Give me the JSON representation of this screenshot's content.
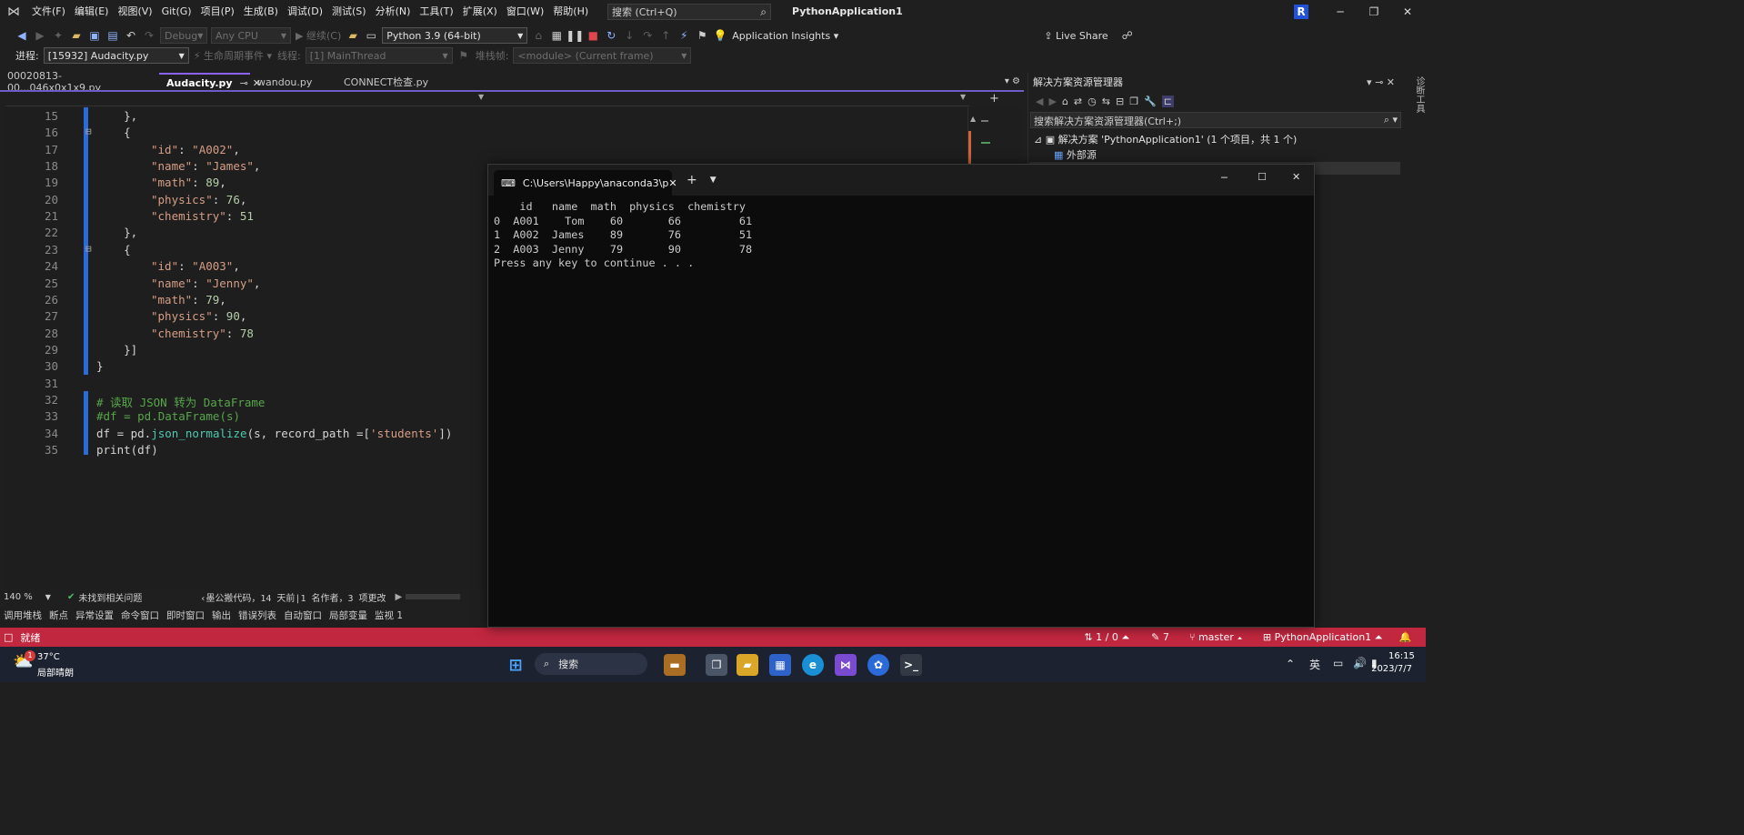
{
  "titlebar": {
    "menu": [
      "文件(F)",
      "编辑(E)",
      "视图(V)",
      "Git(G)",
      "项目(P)",
      "生成(B)",
      "调试(D)",
      "测试(S)",
      "分析(N)",
      "工具(T)",
      "扩展(X)",
      "窗口(W)",
      "帮助(H)"
    ],
    "search_placeholder": "搜索 (Ctrl+Q)",
    "app_title": "PythonApplication1",
    "avatar_letter": "R"
  },
  "toolbar": {
    "config": "Debug",
    "platform": "Any CPU",
    "continue_label": "继续(C)",
    "interpreter": "Python 3.9 (64-bit)",
    "app_insights": "Application Insights",
    "live_share": "Live Share"
  },
  "toolbar2": {
    "process_label": "进程:",
    "process_value": "[15932] Audacity.py",
    "lifecycle_label": "生命周期事件",
    "thread_label": "线程:",
    "thread_value": "[1] MainThread",
    "stackframe_label": "堆栈帧:",
    "stackframe_value": "<module> (Current frame)"
  },
  "tabs": [
    {
      "label": "00020813-00...046x0x1x9.py"
    },
    {
      "label": "Audacity.py"
    },
    {
      "label": "wandou.py"
    },
    {
      "label": "CONNECT检查.py"
    }
  ],
  "editor": {
    "lines": [
      {
        "n": "15",
        "text": "    },"
      },
      {
        "n": "16",
        "text": "    {"
      },
      {
        "n": "17",
        "key": "\"id\"",
        "val": "\"A002\"",
        "kind": "str",
        "end": ","
      },
      {
        "n": "18",
        "key": "\"name\"",
        "val": "\"James\"",
        "kind": "str",
        "end": ","
      },
      {
        "n": "19",
        "key": "\"math\"",
        "val": "89",
        "kind": "num",
        "end": ","
      },
      {
        "n": "20",
        "key": "\"physics\"",
        "val": "76",
        "kind": "num",
        "end": ","
      },
      {
        "n": "21",
        "key": "\"chemistry\"",
        "val": "51",
        "kind": "num",
        "end": ""
      },
      {
        "n": "22",
        "text": "    },"
      },
      {
        "n": "23",
        "text": "    {"
      },
      {
        "n": "24",
        "key": "\"id\"",
        "val": "\"A003\"",
        "kind": "str",
        "end": ","
      },
      {
        "n": "25",
        "key": "\"name\"",
        "val": "\"Jenny\"",
        "kind": "str",
        "end": ","
      },
      {
        "n": "26",
        "key": "\"math\"",
        "val": "79",
        "kind": "num",
        "end": ","
      },
      {
        "n": "27",
        "key": "\"physics\"",
        "val": "90",
        "kind": "num",
        "end": ","
      },
      {
        "n": "28",
        "key": "\"chemistry\"",
        "val": "78",
        "kind": "num",
        "end": ""
      },
      {
        "n": "29",
        "text": "    }]"
      },
      {
        "n": "30",
        "text": "}"
      },
      {
        "n": "31",
        "text": ""
      },
      {
        "n": "32",
        "comment": "# 读取 JSON 转为 DataFrame"
      },
      {
        "n": "33",
        "comment": "#df = pd.DataFrame(s)"
      },
      {
        "n": "34",
        "code34": true
      },
      {
        "n": "35",
        "text": "print(df)"
      }
    ],
    "line34": {
      "pre": "df = pd.",
      "fn": "json_normalize",
      "mid": "(s, record_path =[",
      "str": "'students'",
      "post": "])"
    }
  },
  "editor_status": {
    "zoom": "140 %",
    "issues": "未找到相关问题",
    "codelens": "墨公搬代码，14 天前|1 名作者，3 项更改"
  },
  "tool_tabs": [
    "调用堆栈",
    "断点",
    "异常设置",
    "命令窗口",
    "即时窗口",
    "输出",
    "错误列表",
    "自动窗口",
    "局部变量",
    "监视 1"
  ],
  "statusbar": {
    "ready": "就绪",
    "lines": "1 / 0",
    "edits": "7",
    "branch": "master",
    "project": "PythonApplication1"
  },
  "solution_explorer": {
    "title": "解决方案资源管理器",
    "search": "搜索解决方案资源管理器(Ctrl+;)",
    "solution": "解决方案 'PythonApplication1' (1 个项目，共 1 个)",
    "child": "外部源",
    "side_label": "诊断工具"
  },
  "terminal": {
    "tab_title": "C:\\Users\\Happy\\anaconda3\\p",
    "output_lines": [
      "    id   name  math  physics  chemistry",
      "0  A001    Tom    60       66         61",
      "1  A002  James    89       76         51",
      "2  A003  Jenny    79       90         78",
      "Press any key to continue . . ."
    ]
  },
  "taskbar": {
    "weather_temp": "37°C",
    "weather_desc": "局部晴朗",
    "weather_badge": "1",
    "search_label": "搜索",
    "ime": "英",
    "time": "16:15",
    "date": "2023/7/7"
  },
  "colors": {
    "accent": "#6f5bc8",
    "statusbar": "#c1273f",
    "string": "#d69d85",
    "number": "#b5cea8",
    "comment": "#57a64a"
  }
}
